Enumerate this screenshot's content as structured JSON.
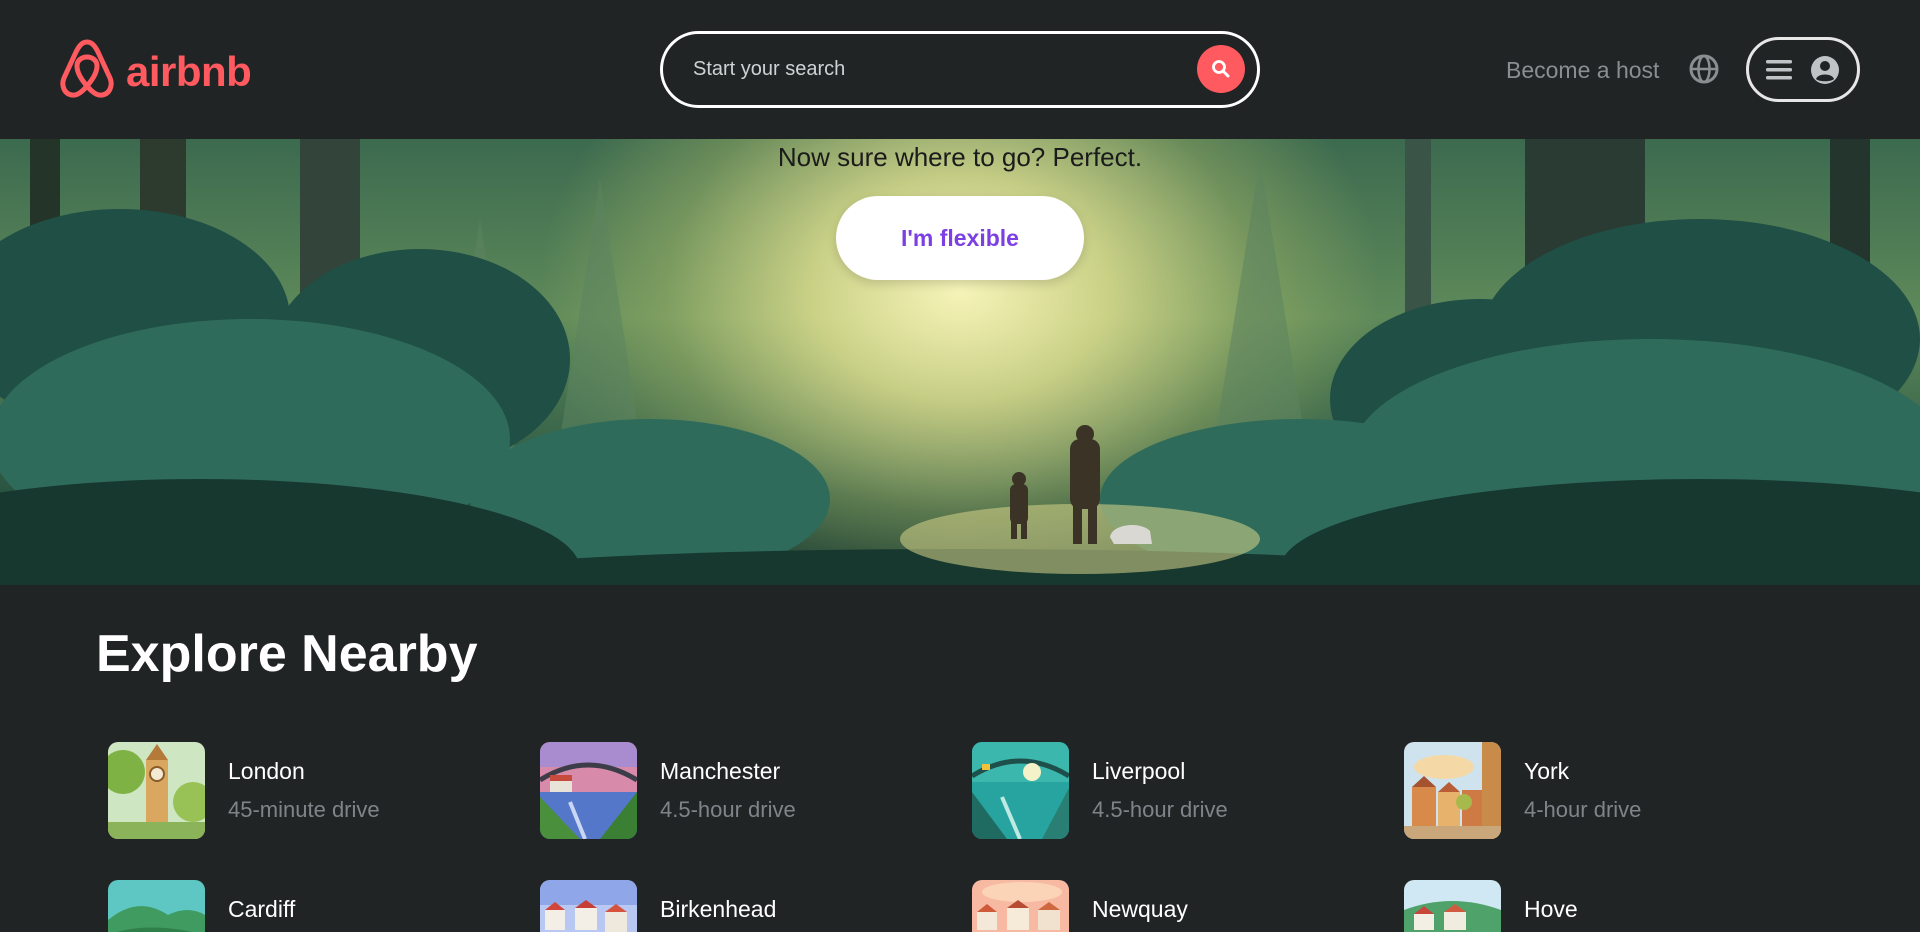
{
  "header": {
    "logo_text": "airbnb",
    "search_placeholder": "Start your search",
    "become_host": "Become a host",
    "icons": [
      "airbnb-logo-icon",
      "search-icon",
      "globe-icon",
      "menu-icon",
      "user-icon"
    ]
  },
  "hero": {
    "tagline": "Now sure where to go? Perfect.",
    "button_label": "I'm flexible"
  },
  "explore": {
    "title": "Explore Nearby",
    "items": [
      {
        "city": "London",
        "drive": "45-minute drive"
      },
      {
        "city": "Manchester",
        "drive": "4.5-hour drive"
      },
      {
        "city": "Liverpool",
        "drive": "4.5-hour drive"
      },
      {
        "city": "York",
        "drive": "4-hour drive"
      },
      {
        "city": "Cardiff",
        "drive": ""
      },
      {
        "city": "Birkenhead",
        "drive": ""
      },
      {
        "city": "Newquay",
        "drive": ""
      },
      {
        "city": "Hove",
        "drive": ""
      }
    ]
  },
  "colors": {
    "brand": "#ff5a5f",
    "accent_purple": "#7b3fe4",
    "background": "#212425",
    "muted_text": "#7f8488"
  }
}
